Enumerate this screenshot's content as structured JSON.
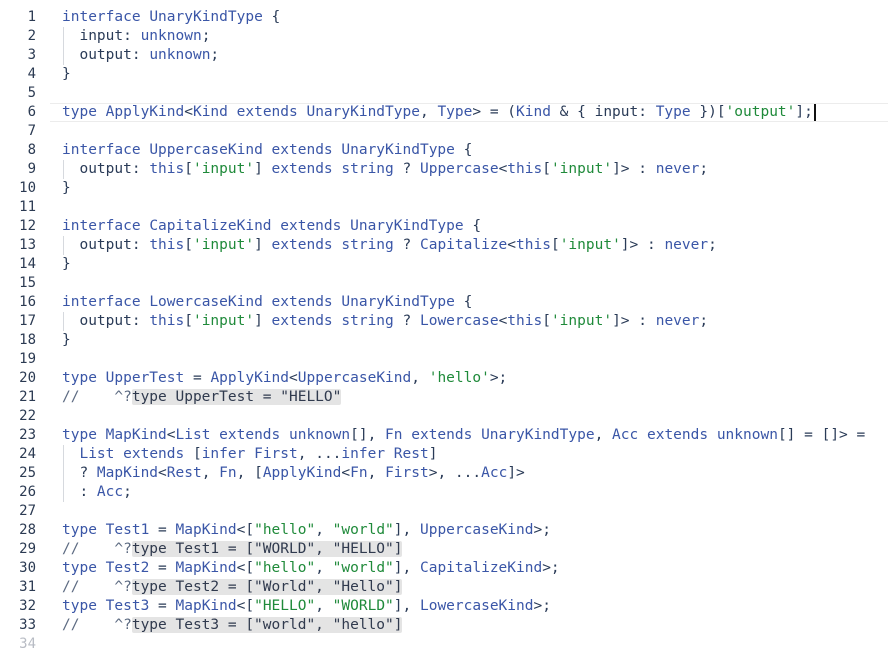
{
  "editor": {
    "lines": [
      {
        "n": "1",
        "segs": [
          [
            "kw",
            "interface"
          ],
          [
            "t",
            " "
          ],
          [
            "ty",
            "UnaryKindType"
          ],
          [
            "t",
            " {"
          ]
        ]
      },
      {
        "n": "2",
        "segs": [
          [
            "t",
            "  input: "
          ],
          [
            "kw",
            "unknown"
          ],
          [
            "t",
            ";"
          ]
        ]
      },
      {
        "n": "3",
        "segs": [
          [
            "t",
            "  output: "
          ],
          [
            "kw",
            "unknown"
          ],
          [
            "t",
            ";"
          ]
        ]
      },
      {
        "n": "4",
        "segs": [
          [
            "t",
            "}"
          ]
        ]
      },
      {
        "n": "5",
        "segs": []
      },
      {
        "n": "6",
        "current": true,
        "segs": [
          [
            "kw",
            "type"
          ],
          [
            "t",
            " "
          ],
          [
            "ty",
            "ApplyKind"
          ],
          [
            "t",
            "<"
          ],
          [
            "ty",
            "Kind"
          ],
          [
            "t",
            " "
          ],
          [
            "kw",
            "extends"
          ],
          [
            "t",
            " "
          ],
          [
            "ty",
            "UnaryKindType"
          ],
          [
            "t",
            ", "
          ],
          [
            "ty",
            "Type"
          ],
          [
            "t",
            "> = ("
          ],
          [
            "ty",
            "Kind"
          ],
          [
            "t",
            " & { input: "
          ],
          [
            "ty",
            "Type"
          ],
          [
            "t",
            " })["
          ],
          [
            "str",
            "'output'"
          ],
          [
            "t",
            "];"
          ],
          [
            "caret",
            ""
          ]
        ]
      },
      {
        "n": "7",
        "segs": []
      },
      {
        "n": "8",
        "segs": [
          [
            "kw",
            "interface"
          ],
          [
            "t",
            " "
          ],
          [
            "ty",
            "UppercaseKind"
          ],
          [
            "t",
            " "
          ],
          [
            "kw",
            "extends"
          ],
          [
            "t",
            " "
          ],
          [
            "ty",
            "UnaryKindType"
          ],
          [
            "t",
            " {"
          ]
        ]
      },
      {
        "n": "9",
        "segs": [
          [
            "t",
            "  output: "
          ],
          [
            "kw",
            "this"
          ],
          [
            "t",
            "["
          ],
          [
            "str",
            "'input'"
          ],
          [
            "t",
            "] "
          ],
          [
            "kw",
            "extends"
          ],
          [
            "t",
            " "
          ],
          [
            "kw",
            "string"
          ],
          [
            "t",
            " ? "
          ],
          [
            "ty",
            "Uppercase"
          ],
          [
            "t",
            "<"
          ],
          [
            "kw",
            "this"
          ],
          [
            "t",
            "["
          ],
          [
            "str",
            "'input'"
          ],
          [
            "t",
            "]> : "
          ],
          [
            "kw",
            "never"
          ],
          [
            "t",
            ";"
          ]
        ]
      },
      {
        "n": "10",
        "segs": [
          [
            "t",
            "}"
          ]
        ]
      },
      {
        "n": "11",
        "segs": []
      },
      {
        "n": "12",
        "segs": [
          [
            "kw",
            "interface"
          ],
          [
            "t",
            " "
          ],
          [
            "ty",
            "CapitalizeKind"
          ],
          [
            "t",
            " "
          ],
          [
            "kw",
            "extends"
          ],
          [
            "t",
            " "
          ],
          [
            "ty",
            "UnaryKindType"
          ],
          [
            "t",
            " {"
          ]
        ]
      },
      {
        "n": "13",
        "segs": [
          [
            "t",
            "  output: "
          ],
          [
            "kw",
            "this"
          ],
          [
            "t",
            "["
          ],
          [
            "str",
            "'input'"
          ],
          [
            "t",
            "] "
          ],
          [
            "kw",
            "extends"
          ],
          [
            "t",
            " "
          ],
          [
            "kw",
            "string"
          ],
          [
            "t",
            " ? "
          ],
          [
            "ty",
            "Capitalize"
          ],
          [
            "t",
            "<"
          ],
          [
            "kw",
            "this"
          ],
          [
            "t",
            "["
          ],
          [
            "str",
            "'input'"
          ],
          [
            "t",
            "]> : "
          ],
          [
            "kw",
            "never"
          ],
          [
            "t",
            ";"
          ]
        ]
      },
      {
        "n": "14",
        "segs": [
          [
            "t",
            "}"
          ]
        ]
      },
      {
        "n": "15",
        "segs": []
      },
      {
        "n": "16",
        "segs": [
          [
            "kw",
            "interface"
          ],
          [
            "t",
            " "
          ],
          [
            "ty",
            "LowercaseKind"
          ],
          [
            "t",
            " "
          ],
          [
            "kw",
            "extends"
          ],
          [
            "t",
            " "
          ],
          [
            "ty",
            "UnaryKindType"
          ],
          [
            "t",
            " {"
          ]
        ]
      },
      {
        "n": "17",
        "segs": [
          [
            "t",
            "  output: "
          ],
          [
            "kw",
            "this"
          ],
          [
            "t",
            "["
          ],
          [
            "str",
            "'input'"
          ],
          [
            "t",
            "] "
          ],
          [
            "kw",
            "extends"
          ],
          [
            "t",
            " "
          ],
          [
            "kw",
            "string"
          ],
          [
            "t",
            " ? "
          ],
          [
            "ty",
            "Lowercase"
          ],
          [
            "t",
            "<"
          ],
          [
            "kw",
            "this"
          ],
          [
            "t",
            "["
          ],
          [
            "str",
            "'input'"
          ],
          [
            "t",
            "]> : "
          ],
          [
            "kw",
            "never"
          ],
          [
            "t",
            ";"
          ]
        ]
      },
      {
        "n": "18",
        "segs": [
          [
            "t",
            "}"
          ]
        ]
      },
      {
        "n": "19",
        "segs": []
      },
      {
        "n": "20",
        "segs": [
          [
            "kw",
            "type"
          ],
          [
            "t",
            " "
          ],
          [
            "ty",
            "UpperTest"
          ],
          [
            "t",
            " = "
          ],
          [
            "ty",
            "ApplyKind"
          ],
          [
            "t",
            "<"
          ],
          [
            "ty",
            "UppercaseKind"
          ],
          [
            "t",
            ", "
          ],
          [
            "str",
            "'hello'"
          ],
          [
            "t",
            ">;"
          ]
        ]
      },
      {
        "n": "21",
        "segs": [
          [
            "cm",
            "//    ^?"
          ],
          [
            "hint",
            "type UpperTest = \"HELLO\""
          ]
        ]
      },
      {
        "n": "22",
        "segs": []
      },
      {
        "n": "23",
        "segs": [
          [
            "kw",
            "type"
          ],
          [
            "t",
            " "
          ],
          [
            "ty",
            "MapKind"
          ],
          [
            "t",
            "<"
          ],
          [
            "ty",
            "List"
          ],
          [
            "t",
            " "
          ],
          [
            "kw",
            "extends"
          ],
          [
            "t",
            " "
          ],
          [
            "kw",
            "unknown"
          ],
          [
            "t",
            "[], "
          ],
          [
            "ty",
            "Fn"
          ],
          [
            "t",
            " "
          ],
          [
            "kw",
            "extends"
          ],
          [
            "t",
            " "
          ],
          [
            "ty",
            "UnaryKindType"
          ],
          [
            "t",
            ", "
          ],
          [
            "ty",
            "Acc"
          ],
          [
            "t",
            " "
          ],
          [
            "kw",
            "extends"
          ],
          [
            "t",
            " "
          ],
          [
            "kw",
            "unknown"
          ],
          [
            "t",
            "[] = []> ="
          ]
        ]
      },
      {
        "n": "24",
        "segs": [
          [
            "t",
            "  "
          ],
          [
            "ty",
            "List"
          ],
          [
            "t",
            " "
          ],
          [
            "kw",
            "extends"
          ],
          [
            "t",
            " ["
          ],
          [
            "kw",
            "infer"
          ],
          [
            "t",
            " "
          ],
          [
            "ty",
            "First"
          ],
          [
            "t",
            ", ..."
          ],
          [
            "kw",
            "infer"
          ],
          [
            "t",
            " "
          ],
          [
            "ty",
            "Rest"
          ],
          [
            "t",
            "]"
          ]
        ]
      },
      {
        "n": "25",
        "segs": [
          [
            "t",
            "  ? "
          ],
          [
            "ty",
            "MapKind"
          ],
          [
            "t",
            "<"
          ],
          [
            "ty",
            "Rest"
          ],
          [
            "t",
            ", "
          ],
          [
            "ty",
            "Fn"
          ],
          [
            "t",
            ", ["
          ],
          [
            "ty",
            "ApplyKind"
          ],
          [
            "t",
            "<"
          ],
          [
            "ty",
            "Fn"
          ],
          [
            "t",
            ", "
          ],
          [
            "ty",
            "First"
          ],
          [
            "t",
            ">, ..."
          ],
          [
            "ty",
            "Acc"
          ],
          [
            "t",
            "]>"
          ]
        ]
      },
      {
        "n": "26",
        "segs": [
          [
            "t",
            "  : "
          ],
          [
            "ty",
            "Acc"
          ],
          [
            "t",
            ";"
          ]
        ]
      },
      {
        "n": "27",
        "segs": []
      },
      {
        "n": "28",
        "segs": [
          [
            "kw",
            "type"
          ],
          [
            "t",
            " "
          ],
          [
            "ty",
            "Test1"
          ],
          [
            "t",
            " = "
          ],
          [
            "ty",
            "MapKind"
          ],
          [
            "t",
            "<["
          ],
          [
            "str",
            "\"hello\""
          ],
          [
            "t",
            ", "
          ],
          [
            "str",
            "\"world\""
          ],
          [
            "t",
            "], "
          ],
          [
            "ty",
            "UppercaseKind"
          ],
          [
            "t",
            ">;"
          ]
        ]
      },
      {
        "n": "29",
        "segs": [
          [
            "cm",
            "//    ^?"
          ],
          [
            "hint",
            "type Test1 = [\"WORLD\", \"HELLO\"]"
          ]
        ]
      },
      {
        "n": "30",
        "segs": [
          [
            "kw",
            "type"
          ],
          [
            "t",
            " "
          ],
          [
            "ty",
            "Test2"
          ],
          [
            "t",
            " = "
          ],
          [
            "ty",
            "MapKind"
          ],
          [
            "t",
            "<["
          ],
          [
            "str",
            "\"hello\""
          ],
          [
            "t",
            ", "
          ],
          [
            "str",
            "\"world\""
          ],
          [
            "t",
            "], "
          ],
          [
            "ty",
            "CapitalizeKind"
          ],
          [
            "t",
            ">;"
          ]
        ]
      },
      {
        "n": "31",
        "segs": [
          [
            "cm",
            "//    ^?"
          ],
          [
            "hint",
            "type Test2 = [\"World\", \"Hello\"]"
          ]
        ]
      },
      {
        "n": "32",
        "segs": [
          [
            "kw",
            "type"
          ],
          [
            "t",
            " "
          ],
          [
            "ty",
            "Test3"
          ],
          [
            "t",
            " = "
          ],
          [
            "ty",
            "MapKind"
          ],
          [
            "t",
            "<["
          ],
          [
            "str",
            "\"HELLO\""
          ],
          [
            "t",
            ", "
          ],
          [
            "str",
            "\"WORLD\""
          ],
          [
            "t",
            "], "
          ],
          [
            "ty",
            "LowercaseKind"
          ],
          [
            "t",
            ">;"
          ]
        ]
      },
      {
        "n": "33",
        "segs": [
          [
            "cm",
            "//    ^?"
          ],
          [
            "hint",
            "type Test3 = [\"world\", \"hello\"]"
          ]
        ]
      },
      {
        "n": "34",
        "last": true,
        "segs": []
      }
    ]
  }
}
